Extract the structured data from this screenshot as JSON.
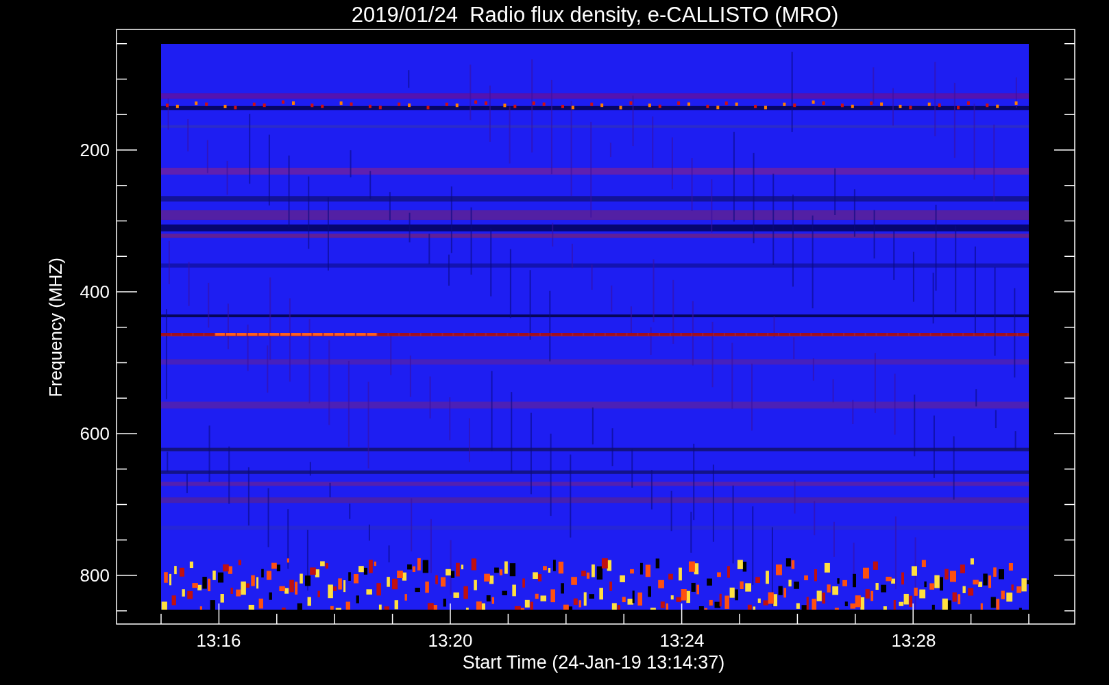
{
  "title": "2019/01/24  Radio flux density, e-CALLISTO (MRO)",
  "y_axis": {
    "label": "Frequency (MHZ)",
    "ticks": [
      "200",
      "400",
      "600",
      "800"
    ]
  },
  "x_axis": {
    "label": "Start Time (24-Jan-19 13:14:37)",
    "ticks": [
      "13:16",
      "13:20",
      "13:24",
      "13:28"
    ]
  }
}
